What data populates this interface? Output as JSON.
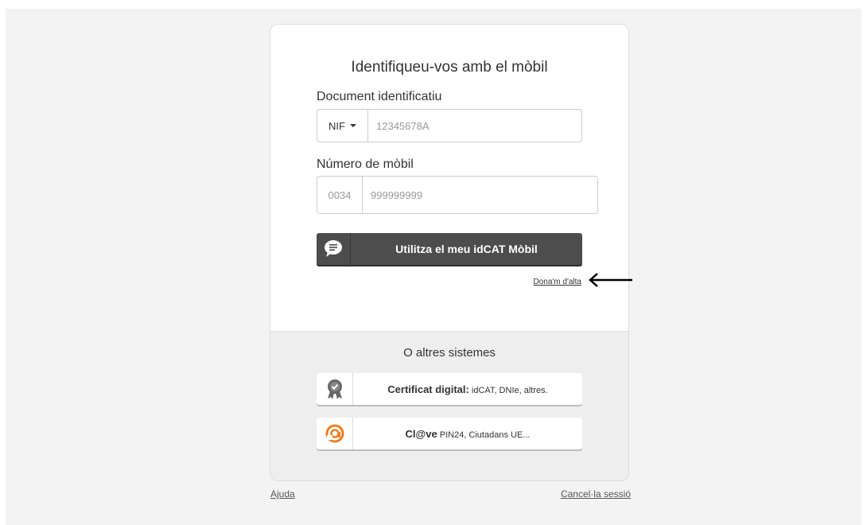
{
  "form": {
    "title": "Identifiqueu-vos amb el mòbil",
    "document_label": "Document identificatiu",
    "document_type": "NIF",
    "document_placeholder": "12345678A",
    "mobile_label": "Número de mòbil",
    "mobile_prefix": "0034",
    "mobile_placeholder": "999999999",
    "submit_label": "Utilitza el meu idCAT Mòbil",
    "signup_link": "Dona'm d'alta"
  },
  "other_systems": {
    "title": "O altres sistemes",
    "certificate": {
      "bold": "Certificat digital:",
      "rest": "idCAT, DNIe, altres."
    },
    "clave": {
      "bold": "Cl@ve",
      "rest": "PIN24, Ciutadans UE..."
    }
  },
  "footer": {
    "help": "Ajuda",
    "cancel": "Cancel·la sessió"
  },
  "icons": {
    "submit": "chat-bubble-icon",
    "certificate": "certificate-badge-icon",
    "clave": "clave-at-icon",
    "annotation": "arrow-left-icon"
  },
  "colors": {
    "primary_button": "#4d4d4d",
    "clave_orange": "#f07d1e",
    "page_background": "#f3f3f3",
    "alt_section_background": "#eeeeee"
  }
}
